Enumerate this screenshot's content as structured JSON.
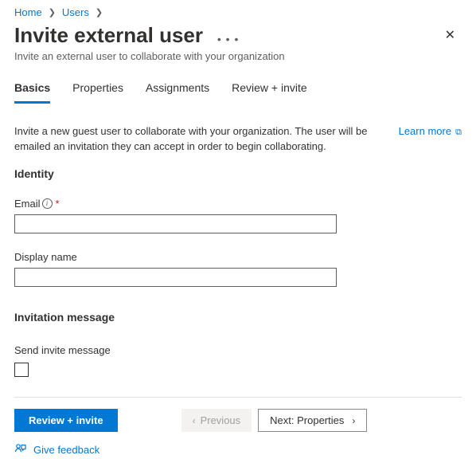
{
  "breadcrumb": {
    "home": "Home",
    "users": "Users"
  },
  "header": {
    "title": "Invite external user",
    "subtitle": "Invite an external user to collaborate with your organization"
  },
  "tabs": {
    "basics": "Basics",
    "properties": "Properties",
    "assignments": "Assignments",
    "review": "Review + invite"
  },
  "intro": {
    "description": "Invite a new guest user to collaborate with your organization. The user will be emailed an invitation they can accept in order to begin collaborating.",
    "learn": "Learn more"
  },
  "sections": {
    "identity": "Identity",
    "invitation": "Invitation message"
  },
  "fields": {
    "email_label": "Email",
    "email_value": "",
    "display_name_label": "Display name",
    "display_name_value": "",
    "send_invite_label": "Send invite message"
  },
  "footer": {
    "review": "Review + invite",
    "previous": "Previous",
    "next": "Next: Properties",
    "feedback": "Give feedback"
  }
}
